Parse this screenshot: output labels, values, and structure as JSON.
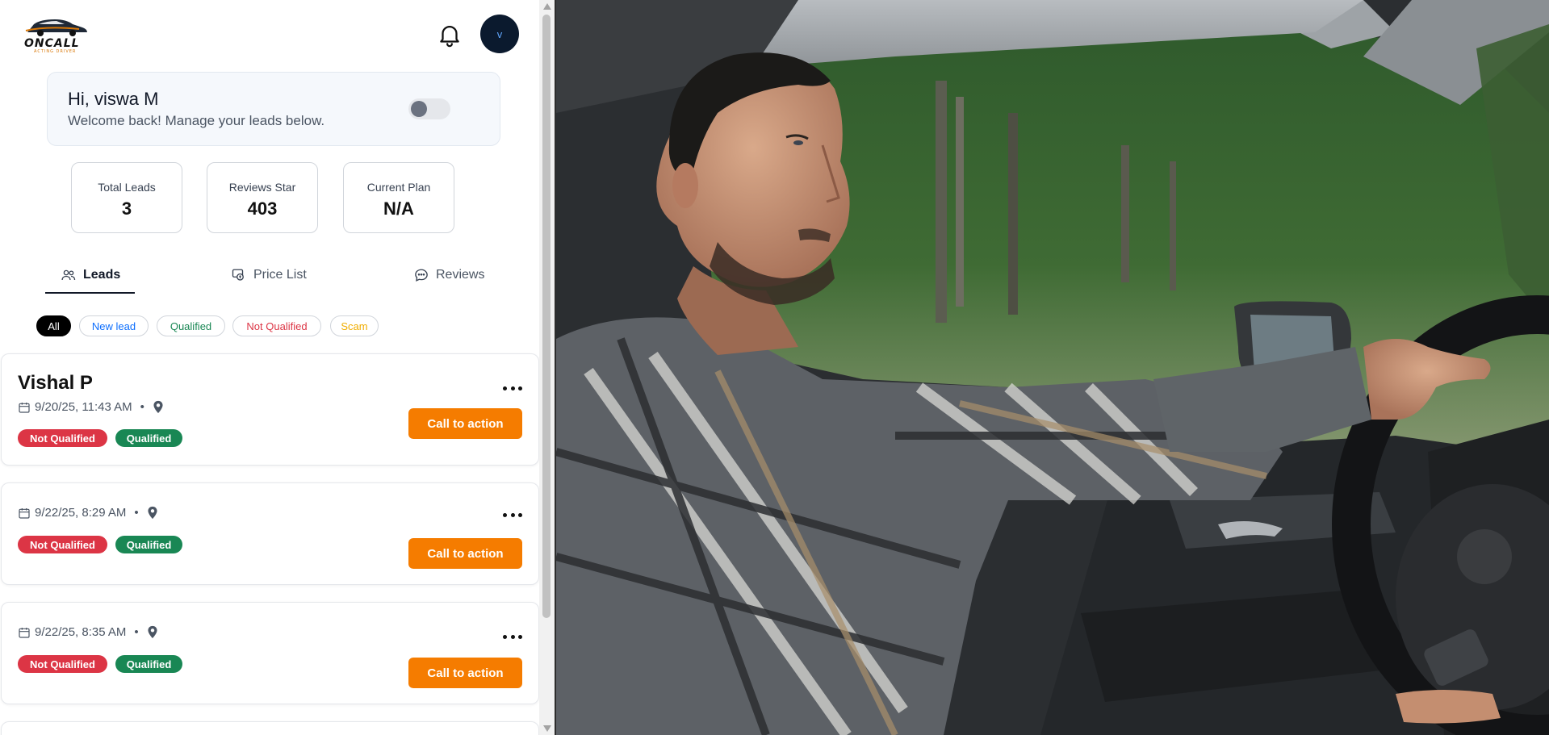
{
  "brand": {
    "name": "ONCALL",
    "tagline": "ACTING DRIVER"
  },
  "header": {
    "avatar_initial": "v"
  },
  "welcome": {
    "title": "Hi, viswa M",
    "subtitle": "Welcome back! Manage your leads below."
  },
  "stats": [
    {
      "label": "Total Leads",
      "value": "3"
    },
    {
      "label": "Reviews Star",
      "value": "403"
    },
    {
      "label": "Current Plan",
      "value": "N/A"
    }
  ],
  "tabs": [
    {
      "label": "Leads",
      "icon": "users-icon",
      "active": true
    },
    {
      "label": "Price List",
      "icon": "price-tag-icon",
      "active": false
    },
    {
      "label": "Reviews",
      "icon": "chat-bubble-icon",
      "active": false
    }
  ],
  "filters": [
    {
      "label": "All",
      "color": "#ffffff"
    },
    {
      "label": "New lead",
      "color": "#0d6efd"
    },
    {
      "label": "Qualified",
      "color": "#198754"
    },
    {
      "label": "Not Qualified",
      "color": "#dc3545"
    },
    {
      "label": "Scam",
      "color": "#f0ad00"
    }
  ],
  "leads": [
    {
      "name": "Vishal P",
      "datetime": "9/20/25, 11:43 AM",
      "dot": "•",
      "badges": [
        "Not Qualified",
        "Qualified"
      ],
      "cta": "Call to action"
    },
    {
      "name": "",
      "datetime": "9/22/25, 8:29 AM",
      "dot": "•",
      "badges": [
        "Not Qualified",
        "Qualified"
      ],
      "cta": "Call to action"
    },
    {
      "name": "",
      "datetime": "9/22/25, 8:35 AM",
      "dot": "•",
      "badges": [
        "Not Qualified",
        "Qualified"
      ],
      "cta": "Call to action"
    }
  ],
  "colors": {
    "accent": "#f57c00",
    "not_qualified": "#dc3545",
    "qualified": "#198754"
  }
}
